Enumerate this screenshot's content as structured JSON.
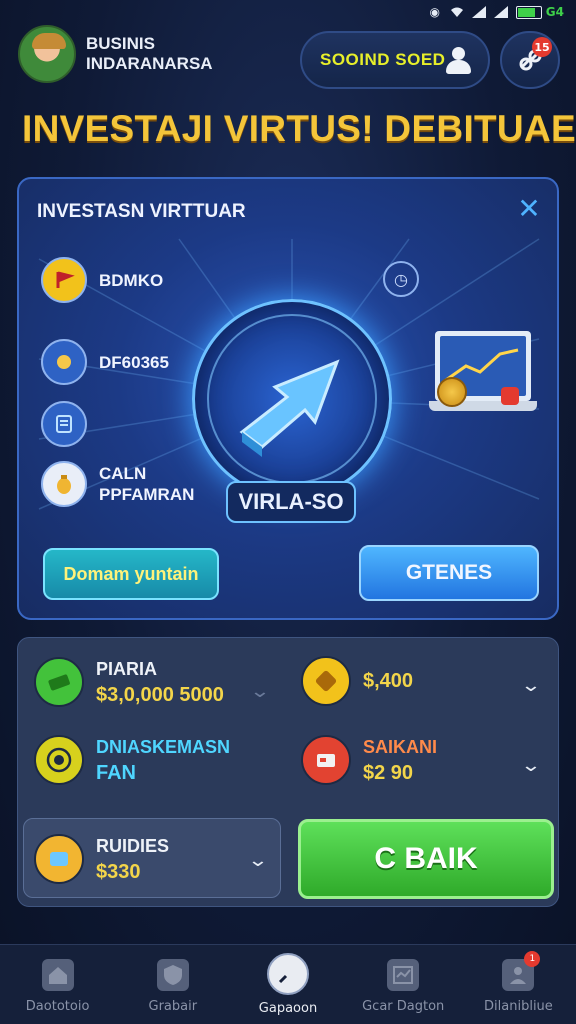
{
  "status_bar": {
    "battery_text": "G4"
  },
  "header": {
    "user_line1": "BUSINIS",
    "user_line2": "INDARANARSA",
    "balance": "SOOIND SOED",
    "notify_badge": "15"
  },
  "page_title": "INVESTAJI VIRTUS! DEBITUAE",
  "main_card": {
    "title": "INVESTASN VIRTTUAR",
    "features": [
      {
        "label": "BDMKO",
        "icon": "flag-icon"
      },
      {
        "label": "DF60365",
        "icon": "sun-icon"
      },
      {
        "label": "",
        "icon": "document-icon"
      },
      {
        "label_line1": "CALN",
        "label_line2": "PPFAMRAN",
        "icon": "coin-bag-icon"
      }
    ],
    "orb_label": "VIRLA-SO",
    "btn_left": "Domam yuntain",
    "btn_right": "GTENES"
  },
  "investments": [
    {
      "name": "PIARIA",
      "value": "$3,0,000 5000",
      "icon": "money-stack-icon",
      "color": "#43c23b"
    },
    {
      "name": "",
      "value": "$,400",
      "icon": "ticket-icon",
      "color": "#f2c21b"
    },
    {
      "name": "DNIASKEMASN",
      "value": "FAN",
      "icon": "target-icon",
      "color": "#d7d11d"
    },
    {
      "name": "SAIKANI",
      "value": "$2 90",
      "icon": "card-icon",
      "color": "#e24331"
    }
  ],
  "bundle": {
    "name": "RUIDIES",
    "value": "$330"
  },
  "back_button": "C BAIK",
  "nav": [
    {
      "label": "Daototoio",
      "icon": "home-icon"
    },
    {
      "label": "Grabair",
      "icon": "shield-icon"
    },
    {
      "label": "Gapaoon",
      "icon": "compass-icon"
    },
    {
      "label": "Gcar Dagton",
      "icon": "chart-icon"
    },
    {
      "label": "Dilanibliue",
      "icon": "profile-icon"
    }
  ],
  "nav_badge": "1"
}
